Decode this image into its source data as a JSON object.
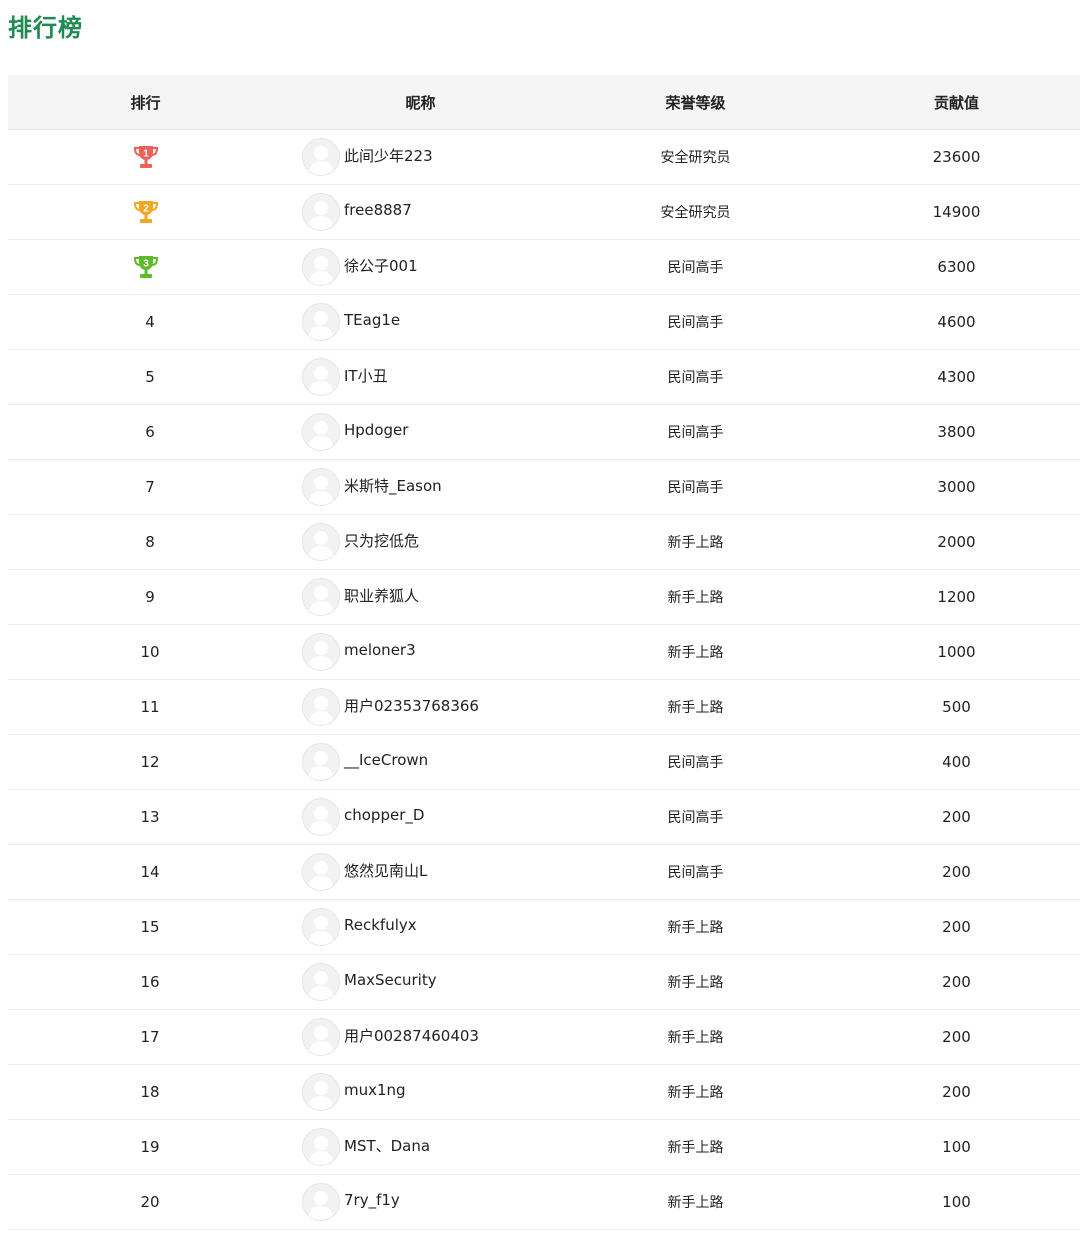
{
  "page": {
    "title": "排行榜"
  },
  "table": {
    "headers": {
      "rank": "排行",
      "nickname": "昵称",
      "level": "荣誉等级",
      "score": "贡献值"
    },
    "trophy_colors": {
      "1": "#f0605a",
      "2": "#f5a623",
      "3": "#5dbb2a"
    },
    "rows": [
      {
        "rank": "1",
        "nickname": "此间少年223",
        "level": "安全研究员",
        "score": "23600"
      },
      {
        "rank": "2",
        "nickname": "free8887",
        "level": "安全研究员",
        "score": "14900"
      },
      {
        "rank": "3",
        "nickname": "徐公子001",
        "level": "民间高手",
        "score": "6300"
      },
      {
        "rank": "4",
        "nickname": "TEag1e",
        "level": "民间高手",
        "score": "4600"
      },
      {
        "rank": "5",
        "nickname": "IT小丑",
        "level": "民间高手",
        "score": "4300"
      },
      {
        "rank": "6",
        "nickname": "Hpdoger",
        "level": "民间高手",
        "score": "3800"
      },
      {
        "rank": "7",
        "nickname": "米斯特_Eason",
        "level": "民间高手",
        "score": "3000"
      },
      {
        "rank": "8",
        "nickname": "只为挖低危",
        "level": "新手上路",
        "score": "2000"
      },
      {
        "rank": "9",
        "nickname": "职业养狐人",
        "level": "新手上路",
        "score": "1200"
      },
      {
        "rank": "10",
        "nickname": "meloner3",
        "level": "新手上路",
        "score": "1000"
      },
      {
        "rank": "11",
        "nickname": "用户02353768366",
        "level": "新手上路",
        "score": "500"
      },
      {
        "rank": "12",
        "nickname": "__IceCrown",
        "level": "民间高手",
        "score": "400"
      },
      {
        "rank": "13",
        "nickname": "chopper_D",
        "level": "民间高手",
        "score": "200"
      },
      {
        "rank": "14",
        "nickname": "悠然见南山L",
        "level": "民间高手",
        "score": "200"
      },
      {
        "rank": "15",
        "nickname": "Reckfulyx",
        "level": "新手上路",
        "score": "200"
      },
      {
        "rank": "16",
        "nickname": "MaxSecurity",
        "level": "新手上路",
        "score": "200"
      },
      {
        "rank": "17",
        "nickname": "用户00287460403",
        "level": "新手上路",
        "score": "200"
      },
      {
        "rank": "18",
        "nickname": "mux1ng",
        "level": "新手上路",
        "score": "200"
      },
      {
        "rank": "19",
        "nickname": "MST、Dana",
        "level": "新手上路",
        "score": "100"
      },
      {
        "rank": "20",
        "nickname": "7ry_f1y",
        "level": "新手上路",
        "score": "100"
      }
    ]
  }
}
